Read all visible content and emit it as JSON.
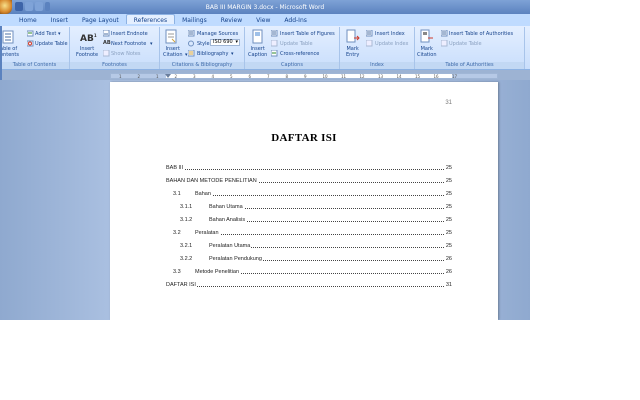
{
  "window": {
    "title": "BAB III MARGIN 3.docx - Microsoft Word"
  },
  "tabs": [
    "Home",
    "Insert",
    "Page Layout",
    "References",
    "Mailings",
    "Review",
    "View",
    "Add-Ins"
  ],
  "active_tab": "References",
  "ribbon": {
    "toc": {
      "label": "Table of Contents",
      "big_button": "able of\nontents",
      "add_text": "Add Text",
      "update_table": "Update Table"
    },
    "footnotes": {
      "label": "Footnotes",
      "insert_footnote": "Insert\nFootnote",
      "insert_endnote": "Insert Endnote",
      "next_footnote": "Next Footnote",
      "show_notes": "Show Notes"
    },
    "citations": {
      "label": "Citations & Bibliography",
      "insert_citation": "Insert\nCitation",
      "manage_sources": "Manage Sources",
      "style_label": "Style:",
      "style_value": "ISO 690",
      "bibliography": "Bibliography"
    },
    "captions": {
      "label": "Captions",
      "insert_caption": "Insert\nCaption",
      "insert_table_of_figures": "Insert Table of Figures",
      "update_table": "Update Table",
      "cross_reference": "Cross-reference"
    },
    "index": {
      "label": "Index",
      "mark_entry": "Mark\nEntry",
      "insert_index": "Insert Index",
      "update_index": "Update Index"
    },
    "authorities": {
      "label": "Table of Authorities",
      "mark_citation": "Mark\nCitation",
      "insert_table": "Insert Table of Authorities",
      "update_table": "Update Table"
    }
  },
  "ruler": {
    "ticks": [
      "1",
      "2",
      "1",
      "2",
      "3",
      "4",
      "5",
      "6",
      "7",
      "8",
      "9",
      "10",
      "11",
      "12",
      "13",
      "14",
      "15",
      "16",
      "17"
    ]
  },
  "document": {
    "page_number": "31",
    "toc_title": "DAFTAR ISI",
    "entries": [
      {
        "num": "",
        "text": "BAB III",
        "page": "25"
      },
      {
        "num": "",
        "text": "BAHAN DAN METODE PENELITIAN",
        "page": "25"
      },
      {
        "num": "3.1",
        "text": "Bahan",
        "page": "25"
      },
      {
        "num": "3.1.1",
        "text": "Bahan Utama",
        "page": "25"
      },
      {
        "num": "3.1.2",
        "text": "Bahan Analisis",
        "page": "25"
      },
      {
        "num": "3.2",
        "text": "Peralatan",
        "page": "25"
      },
      {
        "num": "3.2.1",
        "text": "Peralatan Utama",
        "page": "25"
      },
      {
        "num": "3.2.2",
        "text": "Peralatan Pendukung",
        "page": "26"
      },
      {
        "num": "3.3",
        "text": "Metode Penelitian",
        "page": "26"
      },
      {
        "num": "",
        "text": "DAFTAR ISI",
        "page": "31"
      }
    ]
  }
}
